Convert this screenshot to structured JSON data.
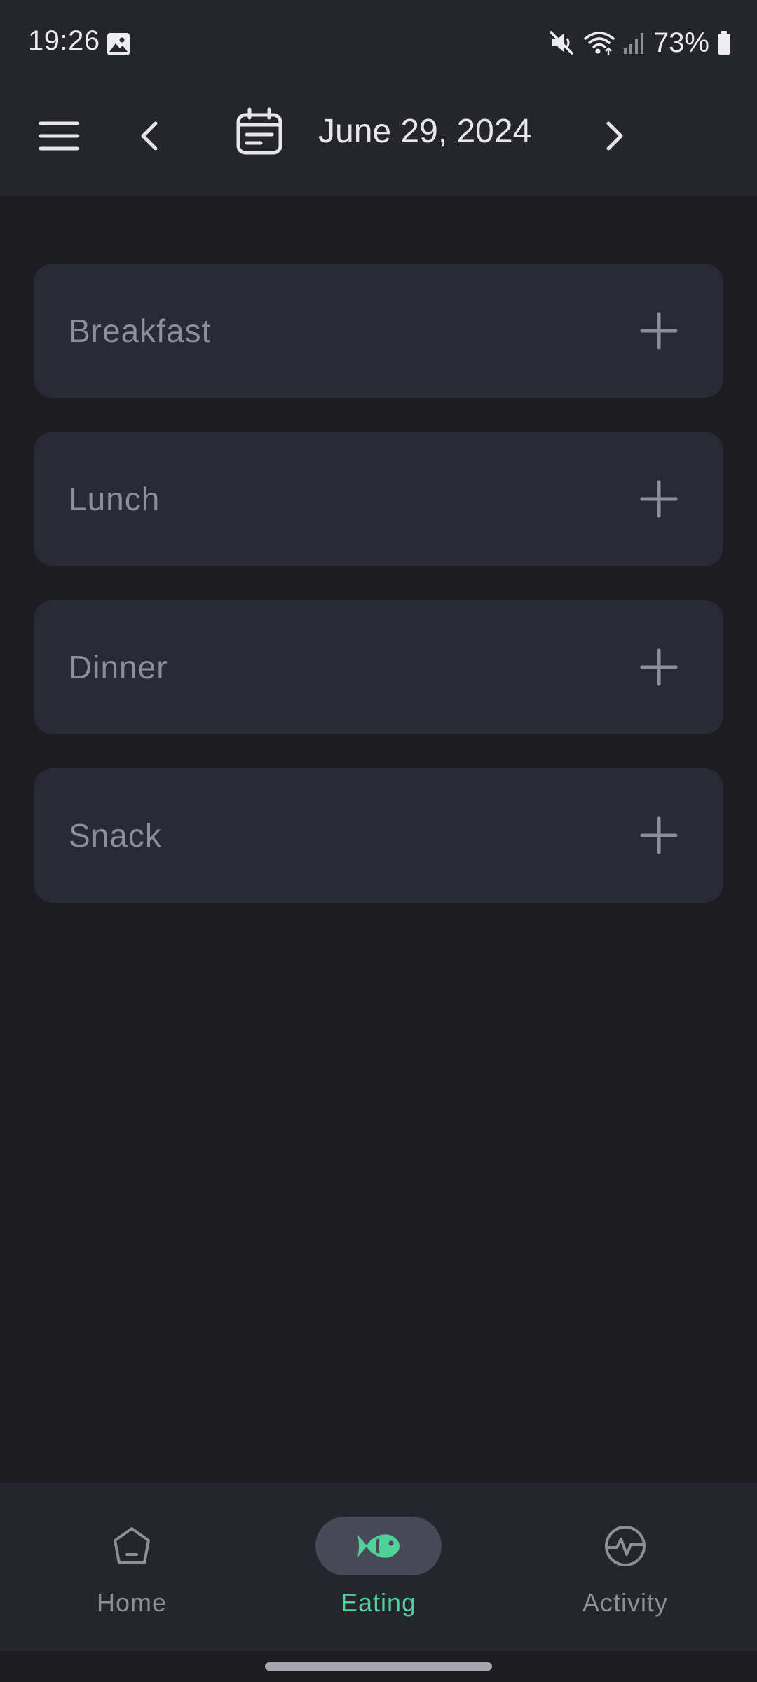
{
  "status_bar": {
    "time": "19:26",
    "battery": "73%",
    "icons": [
      "gallery-icon",
      "mute-icon",
      "wifi-icon",
      "signal-icon",
      "battery-icon"
    ]
  },
  "app_bar": {
    "date": "June 29, 2024",
    "icons": [
      "menu-icon",
      "chevron-left-icon",
      "calendar-icon",
      "chevron-right-icon"
    ]
  },
  "meals": [
    {
      "label": "Breakfast"
    },
    {
      "label": "Lunch"
    },
    {
      "label": "Dinner"
    },
    {
      "label": "Snack"
    }
  ],
  "bottom_nav": {
    "items": [
      {
        "label": "Home",
        "icon": "home-icon",
        "active": false
      },
      {
        "label": "Eating",
        "icon": "fish-icon",
        "active": true
      },
      {
        "label": "Activity",
        "icon": "activity-icon",
        "active": false
      }
    ]
  },
  "colors": {
    "background": "#1c1c21",
    "surface": "#25252e",
    "card": "#2a2a37",
    "accent": "#4fd29a",
    "muted_text": "#8e8e98"
  }
}
